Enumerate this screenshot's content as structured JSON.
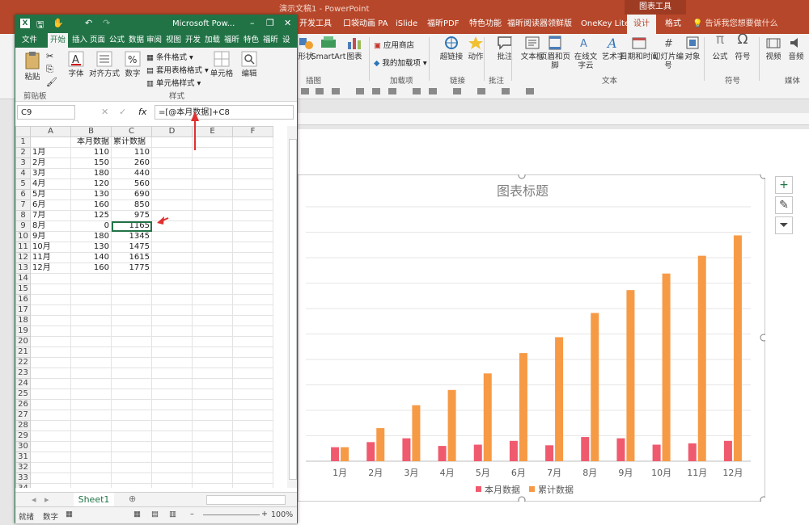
{
  "ppt": {
    "window_title": "演示文稿1 - PowerPoint",
    "tools_title": "图表工具",
    "tabs": [
      "开发工具",
      "口袋动画 PA",
      "iSlide",
      "福昕PDF",
      "特色功能",
      "福昕阅读器领鲜版",
      "OneKey Lite",
      "设计",
      "格式"
    ],
    "tell_me": "告诉我您想要做什么",
    "ribbon": {
      "shapes_label": "形状",
      "smartart_label": "SmartArt",
      "chart_label": "图表",
      "store_label": "应用商店",
      "my_addins_label": "我的加载项",
      "hyperlink_label": "超链接",
      "action_label": "动作",
      "comment_label": "批注",
      "textbox_label": "文本框",
      "header_footer_label": "页眉和页脚",
      "wordcloud_label": "在线文字云",
      "wordart_label": "艺术字",
      "datetime_label": "日期和时间",
      "slide_number_label": "幻灯片编号",
      "object_label": "对象",
      "equation_label": "公式",
      "symbol_label": "符号",
      "video_label": "视频",
      "audio_label": "音频",
      "group_illustrations": "插图",
      "group_addins": "加载项",
      "group_links": "链接",
      "group_comments": "批注",
      "group_text": "文本",
      "group_symbols": "符号",
      "group_media": "媒体"
    }
  },
  "excel": {
    "window_title": "Microsoft Pow...",
    "tabs": [
      "文件",
      "开始",
      "插入",
      "页面",
      "公式",
      "数据",
      "审阅",
      "视图",
      "开发",
      "加载",
      "福昕",
      "特色",
      "福昕",
      "设"
    ],
    "ribbon": {
      "paste_label": "粘贴",
      "font_label": "字体",
      "align_label": "对齐方式",
      "number_label": "数字",
      "cond_format": "条件格式",
      "table_format": "套用表格格式",
      "cell_style": "单元格样式",
      "cells_label": "单元格",
      "edit_label": "编辑",
      "group_clipboard": "剪贴板",
      "group_styles": "样式"
    },
    "name_box": "C9",
    "formula": "=[@本月数据]+C8",
    "columns": [
      "A",
      "B",
      "C",
      "D",
      "E",
      "F"
    ],
    "header_row": {
      "A": "",
      "B": "本月数据",
      "C": "累计数据"
    },
    "rows": [
      {
        "month": "1月",
        "cur": "110",
        "cum": "110"
      },
      {
        "month": "2月",
        "cur": "150",
        "cum": "260"
      },
      {
        "month": "3月",
        "cur": "180",
        "cum": "440"
      },
      {
        "month": "4月",
        "cur": "120",
        "cum": "560"
      },
      {
        "month": "5月",
        "cur": "130",
        "cum": "690"
      },
      {
        "month": "6月",
        "cur": "160",
        "cum": "850"
      },
      {
        "month": "7月",
        "cur": "125",
        "cum": "975"
      },
      {
        "month": "8月",
        "cur": "0",
        "cum": "1165"
      },
      {
        "month": "9月",
        "cur": "180",
        "cum": "1345"
      },
      {
        "month": "10月",
        "cur": "130",
        "cum": "1475"
      },
      {
        "month": "11月",
        "cur": "140",
        "cum": "1615"
      },
      {
        "month": "12月",
        "cur": "160",
        "cum": "1775"
      }
    ],
    "sheet_tab": "Sheet1",
    "status_ready": "就绪",
    "status_num": "数字",
    "zoom": "100%"
  },
  "colors": {
    "ppt_accent": "#b7472a",
    "excel_accent": "#217346",
    "series1": "#f05a6e",
    "series2": "#f79a45"
  },
  "chart_data": {
    "type": "bar",
    "title": "图表标题",
    "categories": [
      "1月",
      "2月",
      "3月",
      "4月",
      "5月",
      "6月",
      "7月",
      "8月",
      "9月",
      "10月",
      "11月",
      "12月"
    ],
    "series": [
      {
        "name": "本月数据",
        "values": [
          110,
          150,
          180,
          120,
          130,
          160,
          125,
          190,
          180,
          130,
          140,
          160
        ]
      },
      {
        "name": "累计数据",
        "values": [
          110,
          260,
          440,
          560,
          690,
          850,
          975,
          1165,
          1345,
          1475,
          1615,
          1775
        ]
      }
    ],
    "ylim": [
      0,
      2000
    ],
    "grid": true,
    "legend": "bottom"
  }
}
